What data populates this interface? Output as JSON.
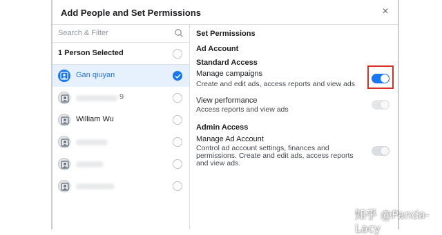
{
  "dialog": {
    "title": "Add People and Set Permissions",
    "close_label": "×"
  },
  "people_panel": {
    "search_placeholder": "Search & Filter",
    "selected_summary": "1 Person Selected",
    "people": [
      {
        "name": "Gan qiuyan",
        "selected": true
      },
      {
        "name": "9",
        "selected": false
      },
      {
        "name": "William Wu",
        "selected": false
      },
      {
        "name": "",
        "selected": false
      },
      {
        "name": "",
        "selected": false
      },
      {
        "name": "",
        "selected": false
      }
    ]
  },
  "permissions": {
    "heading": "Set Permissions",
    "group": "Ad Account",
    "standard_access": "Standard Access",
    "manage_campaigns": {
      "title": "Manage campaigns",
      "desc": "Create and edit ads, access reports and view ads",
      "enabled": true
    },
    "view_performance": {
      "title": "View performance",
      "desc": "Access reports and view ads",
      "enabled": false
    },
    "admin_access": "Admin Access",
    "manage_ad_account": {
      "title": "Manage Ad Account",
      "desc_line1": "Control ad account settings, finances and",
      "desc_line2": "permissions. Create and edit ads, access reports",
      "desc_line3": "and view ads.",
      "enabled": false
    }
  },
  "watermark": "知乎 @Panda-Lacy",
  "colors": {
    "accent": "#1877f2",
    "highlight": "#d93025"
  }
}
